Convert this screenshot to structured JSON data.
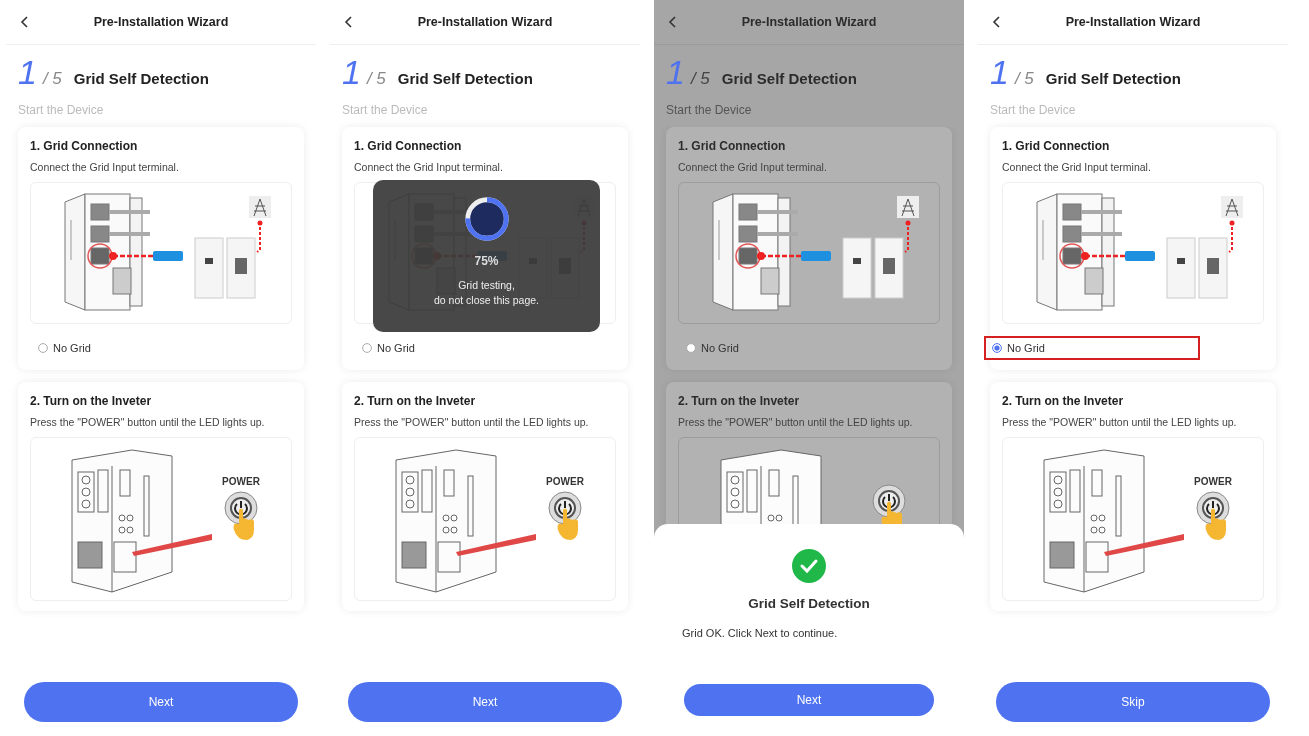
{
  "screens": [
    {
      "dimmed": false,
      "header_title": "Pre-Installation Wizard",
      "step_current": "1",
      "step_total": "/ 5",
      "step_title": "Grid Self Detection",
      "subtitle": "Start the Device",
      "cards": [
        {
          "kind": "grid",
          "title": "1. Grid Connection",
          "text": "Connect the Grid Input  terminal.",
          "option": {
            "label": "No Grid",
            "selected": false,
            "highlighted": false
          }
        },
        {
          "kind": "power",
          "title": "2. Turn on the Inveter",
          "text": "Press the \"POWER\" button until the LED lights up.",
          "power_label": "POWER"
        }
      ],
      "button": "Next"
    },
    {
      "dimmed": false,
      "header_title": "Pre-Installation Wizard",
      "step_current": "1",
      "step_total": "/ 5",
      "step_title": "Grid Self Detection",
      "subtitle": "Start the Device",
      "cards": [
        {
          "kind": "grid",
          "title": "1. Grid Connection",
          "text": "Connect the Grid Input  terminal.",
          "option": {
            "label": "No Grid",
            "selected": false,
            "highlighted": false
          }
        },
        {
          "kind": "power",
          "title": "2. Turn on the Inveter",
          "text": "Press the \"POWER\" button until the LED lights up.",
          "power_label": "POWER"
        }
      ],
      "button": "Next",
      "overlay": {
        "kind": "progress",
        "level": 0.75,
        "percent": "75%",
        "message_lines": [
          "Grid testing,",
          "do not close this page."
        ]
      }
    },
    {
      "dimmed": true,
      "header_title": "Pre-Installation Wizard",
      "step_current": "1",
      "step_total": "/ 5",
      "step_title": "Grid Self Detection",
      "subtitle": "Start the Device",
      "cards": [
        {
          "kind": "grid",
          "title": "1. Grid Connection",
          "text": "Connect the Grid Input  terminal.",
          "option": {
            "label": "No Grid",
            "selected": false,
            "highlighted": false
          }
        },
        {
          "kind": "power",
          "title": "2. Turn on the Inveter",
          "text": "Press the \"POWER\" button until the LED lights up."
        }
      ],
      "overlay": {
        "kind": "sheet",
        "title": "Grid Self Detection",
        "message": "Grid  OK. Click Next to continue.",
        "button": "Next"
      }
    },
    {
      "dimmed": false,
      "header_title": "Pre-Installation Wizard",
      "step_current": "1",
      "step_total": "/ 5",
      "step_title": "Grid Self Detection",
      "subtitle": "Start the Device",
      "cards": [
        {
          "kind": "grid",
          "title": "1. Grid Connection",
          "text": "Connect the Grid Input  terminal.",
          "option": {
            "label": "No Grid",
            "selected": true,
            "highlighted": true
          }
        },
        {
          "kind": "power",
          "title": "2. Turn on the Inveter",
          "text": "Press the \"POWER\" button until the LED lights up.",
          "power_label": "POWER"
        }
      ],
      "button": "Skip"
    }
  ]
}
